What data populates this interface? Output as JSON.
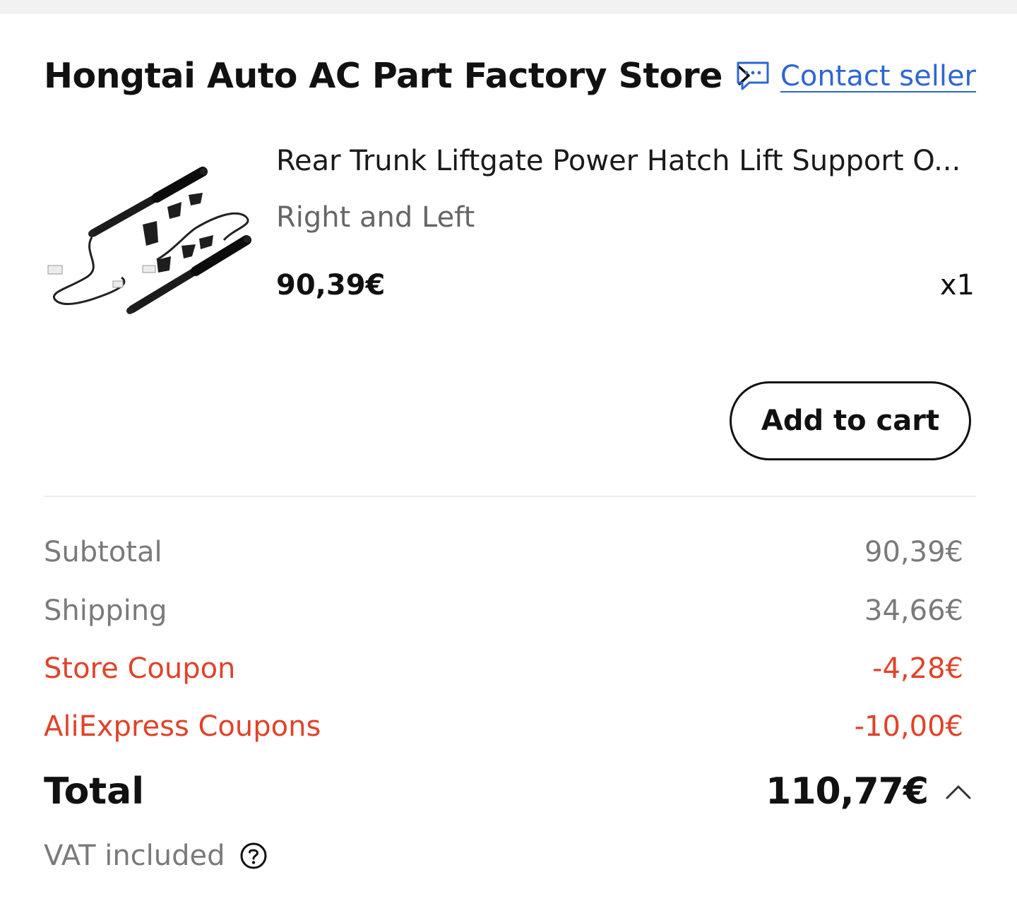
{
  "store": {
    "name": "Hongtai Auto AC Part Factory Store",
    "contact_label": "Contact seller"
  },
  "product": {
    "title": "Rear Trunk Liftgate Power Hatch Lift Support O...",
    "variant": "Right and Left",
    "price": "90,39€",
    "quantity": "x1",
    "add_to_cart_label": "Add to cart"
  },
  "summary": {
    "subtotal_label": "Subtotal",
    "subtotal_value": "90,39€",
    "shipping_label": "Shipping",
    "shipping_value": "34,66€",
    "store_coupon_label": "Store Coupon",
    "store_coupon_value": "-4,28€",
    "aliexpress_coupons_label": "AliExpress Coupons",
    "aliexpress_coupons_value": "-10,00€",
    "total_label": "Total",
    "total_value": "110,77€",
    "vat_label": "VAT included"
  },
  "colors": {
    "link": "#2f66d4",
    "coupon": "#e0432a",
    "muted": "#7a7a7a",
    "text": "#111111"
  },
  "icons": {
    "store_chevron": "chevron-right-icon",
    "contact": "chat-bubble-icon",
    "total_toggle": "chevron-up-icon",
    "vat_help": "question-circle-icon"
  }
}
